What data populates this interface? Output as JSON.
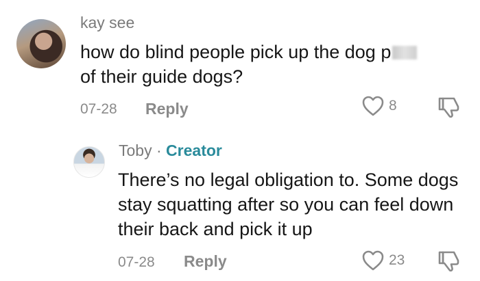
{
  "comment": {
    "username": "kay see",
    "text": "how do blind people pick up the dog p",
    "text_cont": "of their guide dogs?",
    "date": "07-28",
    "reply_label": "Reply",
    "like_count": "8"
  },
  "reply": {
    "username": "Toby",
    "separator": " · ",
    "badge": "Creator",
    "text": "There’s no legal obligation to. Some dogs stay squatting after so you can feel down their back and pick it up",
    "date": "07-28",
    "reply_label": "Reply",
    "like_count": "23"
  },
  "icons": {
    "like": "heart-outline-icon",
    "dislike": "thumbs-down-outline-icon"
  },
  "colors": {
    "text": "#161616",
    "muted": "#8a8a8a",
    "creator": "#2a8b9b",
    "background": "#ffffff"
  }
}
